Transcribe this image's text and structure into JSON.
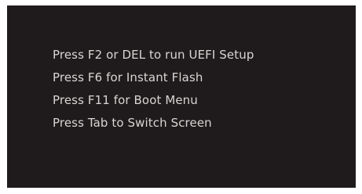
{
  "boot_screen": {
    "background_color": "#1f1b1c",
    "text_color": "#d8d6d4",
    "prompts": [
      "Press F2 or DEL to run UEFI Setup",
      "Press F6 for Instant Flash",
      "Press F11 for Boot Menu",
      "Press Tab to Switch Screen"
    ]
  }
}
